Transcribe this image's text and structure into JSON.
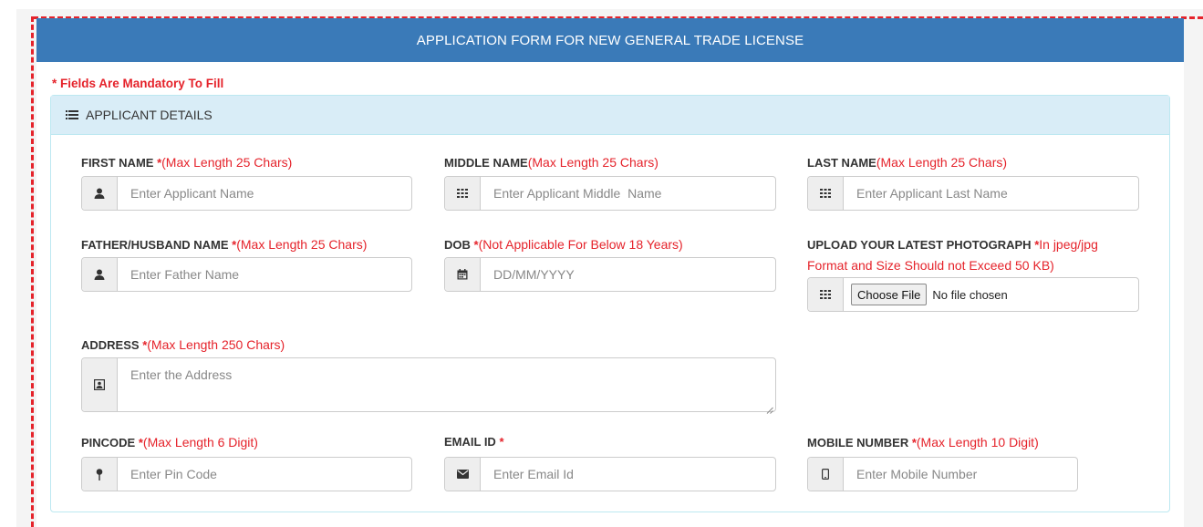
{
  "form": {
    "title": "APPLICATION FORM FOR NEW GENERAL TRADE LICENSE",
    "mandatory_note": "* Fields Are Mandatory To Fill",
    "section_title": "APPLICANT DETAILS",
    "section_icon": "list-icon"
  },
  "fields": {
    "first_name": {
      "label": "FIRST NAME",
      "star": " *",
      "hint": "(Max Length 25 Chars)",
      "placeholder": "Enter Applicant Name",
      "icon": "user-icon"
    },
    "middle_name": {
      "label": "MIDDLE NAME",
      "hint": "(Max Length 25 Chars)",
      "placeholder": "Enter Applicant Middle  Name",
      "icon": "grid-icon"
    },
    "last_name": {
      "label": "LAST NAME",
      "hint": "(Max Length 25 Chars)",
      "placeholder": "Enter Applicant Last Name",
      "icon": "grid-icon"
    },
    "father_name": {
      "label": "FATHER/HUSBAND NAME",
      "star": " *",
      "hint": "(Max Length 25 Chars)",
      "placeholder": "Enter Father Name",
      "icon": "user-icon"
    },
    "dob": {
      "label": "DOB",
      "star": " *",
      "hint": "(Not Applicable For Below 18 Years)",
      "placeholder": "DD/MM/YYYY",
      "icon": "calendar-icon"
    },
    "photo": {
      "label": "UPLOAD YOUR LATEST PHOTOGRAPH",
      "star": " *",
      "hint": "In jpeg/jpg",
      "hint2": "Format and Size Should not Exceed 50 KB)",
      "button": "Choose File",
      "file_status": "No file chosen",
      "icon": "grid-icon"
    },
    "address": {
      "label": "ADDRESS",
      "star": " *",
      "hint": "(Max Length 250 Chars)",
      "placeholder": "Enter the Address",
      "icon": "contact-card-icon"
    },
    "pincode": {
      "label": "PINCODE",
      "star": " *",
      "hint": "(Max Length 6 Digit)",
      "placeholder": "Enter Pin Code",
      "icon": "map-pin-icon"
    },
    "email": {
      "label": "EMAIL ID",
      "star": " *",
      "placeholder": "Enter Email Id",
      "icon": "envelope-icon"
    },
    "mobile": {
      "label": "MOBILE NUMBER",
      "star": " *",
      "hint": "(Max Length 10 Digit)",
      "placeholder": "Enter Mobile Number",
      "icon": "mobile-icon"
    }
  },
  "colors": {
    "header": "#3a7ab8",
    "required": "#e5232b",
    "panel_head": "#d9edf7"
  }
}
